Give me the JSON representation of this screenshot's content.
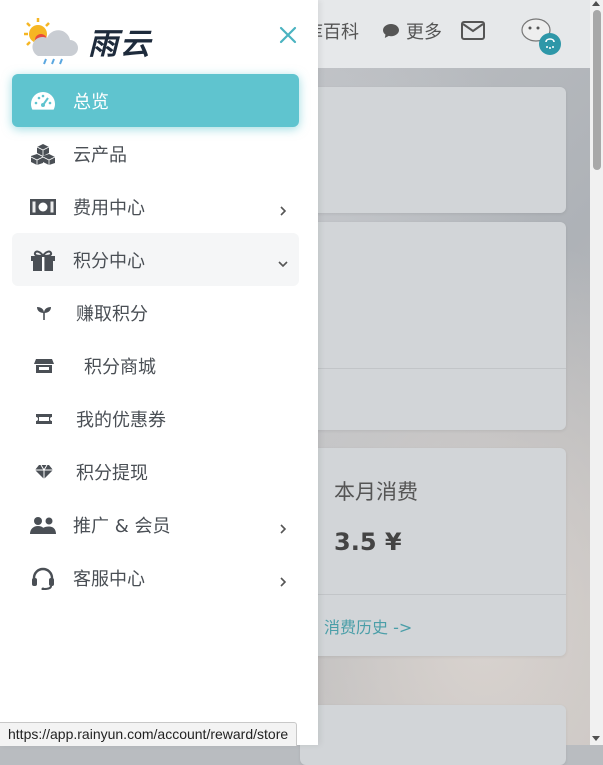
{
  "colors": {
    "accent": "#5fc4cf",
    "link": "#4a9ea8",
    "text": "#4a4f55"
  },
  "logo": {
    "text": "雨云",
    "icon": "weather-sun-cloud-icon"
  },
  "background": {
    "nav": {
      "encyclopedia_fragment": "库百科",
      "more_label": "更多"
    },
    "card_month": {
      "title": "本月消费",
      "value": "3.5 ¥",
      "history_link": "消费历史 ->"
    }
  },
  "menu": {
    "items": [
      {
        "label": "总览",
        "icon": "dashboard-gauge-icon",
        "state": "active"
      },
      {
        "label": "云产品",
        "icon": "cubes-icon"
      },
      {
        "label": "费用中心",
        "icon": "money-bill-icon",
        "arrow": "right"
      },
      {
        "label": "积分中心",
        "icon": "gift-icon",
        "arrow": "down",
        "state": "open"
      },
      {
        "label": "推广 & 会员",
        "icon": "users-icon",
        "arrow": "right"
      },
      {
        "label": "客服中心",
        "icon": "headset-icon",
        "arrow": "right"
      }
    ],
    "sub_items": [
      {
        "label": "赚取积分",
        "icon": "seedling-icon"
      },
      {
        "label": "积分商城",
        "icon": "store-icon"
      },
      {
        "label": "我的优惠券",
        "icon": "ticket-icon"
      },
      {
        "label": "积分提现",
        "icon": "gem-icon"
      }
    ]
  },
  "status_bar": {
    "url": "https://app.rainyun.com/account/reward/store"
  }
}
